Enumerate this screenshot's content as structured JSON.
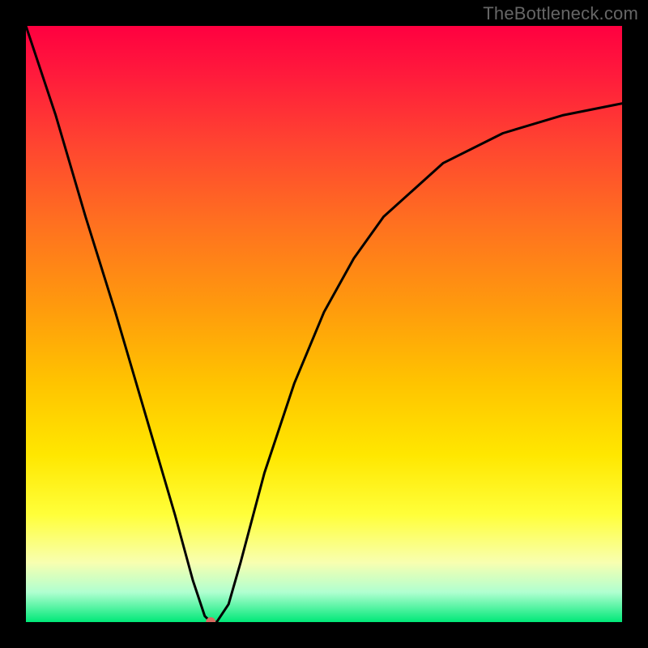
{
  "watermark": "TheBottleneck.com",
  "colors": {
    "frame": "#000000",
    "curve": "#000000",
    "dot": "#d86a60",
    "gradient_top": "#ff0040",
    "gradient_bottom": "#00e878"
  },
  "chart_data": {
    "type": "line",
    "title": "",
    "xlabel": "",
    "ylabel": "",
    "xlim": [
      0,
      100
    ],
    "ylim": [
      0,
      100
    ],
    "grid": false,
    "legend": false,
    "series": [
      {
        "name": "bottleneck-curve",
        "x": [
          0,
          5,
          10,
          15,
          20,
          25,
          28,
          30,
          31,
          32,
          34,
          36,
          40,
          45,
          50,
          55,
          60,
          70,
          80,
          90,
          100
        ],
        "values": [
          100,
          85,
          68,
          52,
          35,
          18,
          7,
          1,
          0,
          0,
          3,
          10,
          25,
          40,
          52,
          61,
          68,
          77,
          82,
          85,
          87
        ]
      }
    ],
    "markers": [
      {
        "name": "optimal-point",
        "x": 31,
        "y": 0
      }
    ]
  }
}
